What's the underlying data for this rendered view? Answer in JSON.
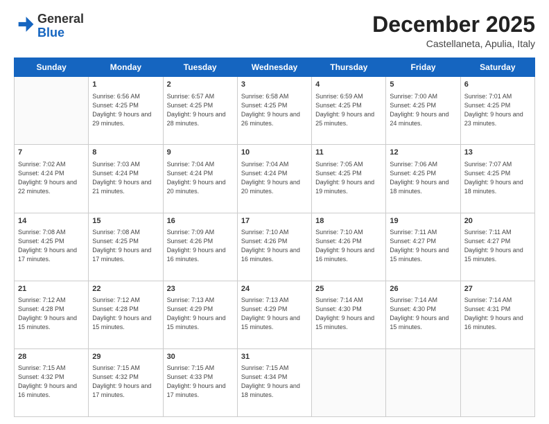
{
  "header": {
    "logo_line1": "General",
    "logo_line2": "Blue",
    "month": "December 2025",
    "location": "Castellaneta, Apulia, Italy"
  },
  "days_of_week": [
    "Sunday",
    "Monday",
    "Tuesday",
    "Wednesday",
    "Thursday",
    "Friday",
    "Saturday"
  ],
  "weeks": [
    [
      {
        "day": "",
        "sunrise": "",
        "sunset": "",
        "daylight": ""
      },
      {
        "day": "1",
        "sunrise": "Sunrise: 6:56 AM",
        "sunset": "Sunset: 4:25 PM",
        "daylight": "Daylight: 9 hours and 29 minutes."
      },
      {
        "day": "2",
        "sunrise": "Sunrise: 6:57 AM",
        "sunset": "Sunset: 4:25 PM",
        "daylight": "Daylight: 9 hours and 28 minutes."
      },
      {
        "day": "3",
        "sunrise": "Sunrise: 6:58 AM",
        "sunset": "Sunset: 4:25 PM",
        "daylight": "Daylight: 9 hours and 26 minutes."
      },
      {
        "day": "4",
        "sunrise": "Sunrise: 6:59 AM",
        "sunset": "Sunset: 4:25 PM",
        "daylight": "Daylight: 9 hours and 25 minutes."
      },
      {
        "day": "5",
        "sunrise": "Sunrise: 7:00 AM",
        "sunset": "Sunset: 4:25 PM",
        "daylight": "Daylight: 9 hours and 24 minutes."
      },
      {
        "day": "6",
        "sunrise": "Sunrise: 7:01 AM",
        "sunset": "Sunset: 4:25 PM",
        "daylight": "Daylight: 9 hours and 23 minutes."
      }
    ],
    [
      {
        "day": "7",
        "sunrise": "Sunrise: 7:02 AM",
        "sunset": "Sunset: 4:24 PM",
        "daylight": "Daylight: 9 hours and 22 minutes."
      },
      {
        "day": "8",
        "sunrise": "Sunrise: 7:03 AM",
        "sunset": "Sunset: 4:24 PM",
        "daylight": "Daylight: 9 hours and 21 minutes."
      },
      {
        "day": "9",
        "sunrise": "Sunrise: 7:04 AM",
        "sunset": "Sunset: 4:24 PM",
        "daylight": "Daylight: 9 hours and 20 minutes."
      },
      {
        "day": "10",
        "sunrise": "Sunrise: 7:04 AM",
        "sunset": "Sunset: 4:24 PM",
        "daylight": "Daylight: 9 hours and 20 minutes."
      },
      {
        "day": "11",
        "sunrise": "Sunrise: 7:05 AM",
        "sunset": "Sunset: 4:25 PM",
        "daylight": "Daylight: 9 hours and 19 minutes."
      },
      {
        "day": "12",
        "sunrise": "Sunrise: 7:06 AM",
        "sunset": "Sunset: 4:25 PM",
        "daylight": "Daylight: 9 hours and 18 minutes."
      },
      {
        "day": "13",
        "sunrise": "Sunrise: 7:07 AM",
        "sunset": "Sunset: 4:25 PM",
        "daylight": "Daylight: 9 hours and 18 minutes."
      }
    ],
    [
      {
        "day": "14",
        "sunrise": "Sunrise: 7:08 AM",
        "sunset": "Sunset: 4:25 PM",
        "daylight": "Daylight: 9 hours and 17 minutes."
      },
      {
        "day": "15",
        "sunrise": "Sunrise: 7:08 AM",
        "sunset": "Sunset: 4:25 PM",
        "daylight": "Daylight: 9 hours and 17 minutes."
      },
      {
        "day": "16",
        "sunrise": "Sunrise: 7:09 AM",
        "sunset": "Sunset: 4:26 PM",
        "daylight": "Daylight: 9 hours and 16 minutes."
      },
      {
        "day": "17",
        "sunrise": "Sunrise: 7:10 AM",
        "sunset": "Sunset: 4:26 PM",
        "daylight": "Daylight: 9 hours and 16 minutes."
      },
      {
        "day": "18",
        "sunrise": "Sunrise: 7:10 AM",
        "sunset": "Sunset: 4:26 PM",
        "daylight": "Daylight: 9 hours and 16 minutes."
      },
      {
        "day": "19",
        "sunrise": "Sunrise: 7:11 AM",
        "sunset": "Sunset: 4:27 PM",
        "daylight": "Daylight: 9 hours and 15 minutes."
      },
      {
        "day": "20",
        "sunrise": "Sunrise: 7:11 AM",
        "sunset": "Sunset: 4:27 PM",
        "daylight": "Daylight: 9 hours and 15 minutes."
      }
    ],
    [
      {
        "day": "21",
        "sunrise": "Sunrise: 7:12 AM",
        "sunset": "Sunset: 4:28 PM",
        "daylight": "Daylight: 9 hours and 15 minutes."
      },
      {
        "day": "22",
        "sunrise": "Sunrise: 7:12 AM",
        "sunset": "Sunset: 4:28 PM",
        "daylight": "Daylight: 9 hours and 15 minutes."
      },
      {
        "day": "23",
        "sunrise": "Sunrise: 7:13 AM",
        "sunset": "Sunset: 4:29 PM",
        "daylight": "Daylight: 9 hours and 15 minutes."
      },
      {
        "day": "24",
        "sunrise": "Sunrise: 7:13 AM",
        "sunset": "Sunset: 4:29 PM",
        "daylight": "Daylight: 9 hours and 15 minutes."
      },
      {
        "day": "25",
        "sunrise": "Sunrise: 7:14 AM",
        "sunset": "Sunset: 4:30 PM",
        "daylight": "Daylight: 9 hours and 15 minutes."
      },
      {
        "day": "26",
        "sunrise": "Sunrise: 7:14 AM",
        "sunset": "Sunset: 4:30 PM",
        "daylight": "Daylight: 9 hours and 15 minutes."
      },
      {
        "day": "27",
        "sunrise": "Sunrise: 7:14 AM",
        "sunset": "Sunset: 4:31 PM",
        "daylight": "Daylight: 9 hours and 16 minutes."
      }
    ],
    [
      {
        "day": "28",
        "sunrise": "Sunrise: 7:15 AM",
        "sunset": "Sunset: 4:32 PM",
        "daylight": "Daylight: 9 hours and 16 minutes."
      },
      {
        "day": "29",
        "sunrise": "Sunrise: 7:15 AM",
        "sunset": "Sunset: 4:32 PM",
        "daylight": "Daylight: 9 hours and 17 minutes."
      },
      {
        "day": "30",
        "sunrise": "Sunrise: 7:15 AM",
        "sunset": "Sunset: 4:33 PM",
        "daylight": "Daylight: 9 hours and 17 minutes."
      },
      {
        "day": "31",
        "sunrise": "Sunrise: 7:15 AM",
        "sunset": "Sunset: 4:34 PM",
        "daylight": "Daylight: 9 hours and 18 minutes."
      },
      {
        "day": "",
        "sunrise": "",
        "sunset": "",
        "daylight": ""
      },
      {
        "day": "",
        "sunrise": "",
        "sunset": "",
        "daylight": ""
      },
      {
        "day": "",
        "sunrise": "",
        "sunset": "",
        "daylight": ""
      }
    ]
  ]
}
